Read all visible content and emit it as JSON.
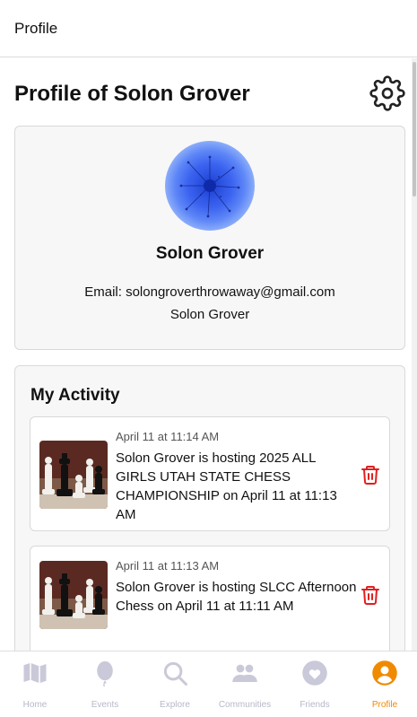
{
  "header": {
    "title": "Profile"
  },
  "page": {
    "title": "Profile of Solon Grover"
  },
  "profile": {
    "name": "Solon Grover",
    "email_line": "Email: solongroverthrowaway@gmail.com",
    "subline": "Solon Grover",
    "avatar_icon": "blue-flower-avatar"
  },
  "activity": {
    "title": "My Activity",
    "items": [
      {
        "time": "April 11 at 11:14 AM",
        "text": "Solon Grover is hosting 2025 ALL GIRLS UTAH STATE CHESS CHAMPIONSHIP on April 11 at 11:13 AM",
        "image_icon": "chess-pieces-image"
      },
      {
        "time": "April 11 at 11:13 AM",
        "text": "Solon Grover is hosting SLCC Afternoon Chess on April 11 at 11:11 AM",
        "image_icon": "chess-pieces-image"
      }
    ]
  },
  "nav": {
    "items": [
      {
        "label": "Home",
        "icon": "map-icon"
      },
      {
        "label": "Events",
        "icon": "balloon-icon"
      },
      {
        "label": "Explore",
        "icon": "search-icon"
      },
      {
        "label": "Communities",
        "icon": "people-icon"
      },
      {
        "label": "Friends",
        "icon": "heart-icon"
      },
      {
        "label": "Profile",
        "icon": "user-icon"
      }
    ],
    "active": "Profile"
  },
  "colors": {
    "accent": "#f08a00",
    "inactive": "#b8b8c8",
    "delete": "#e02020"
  }
}
